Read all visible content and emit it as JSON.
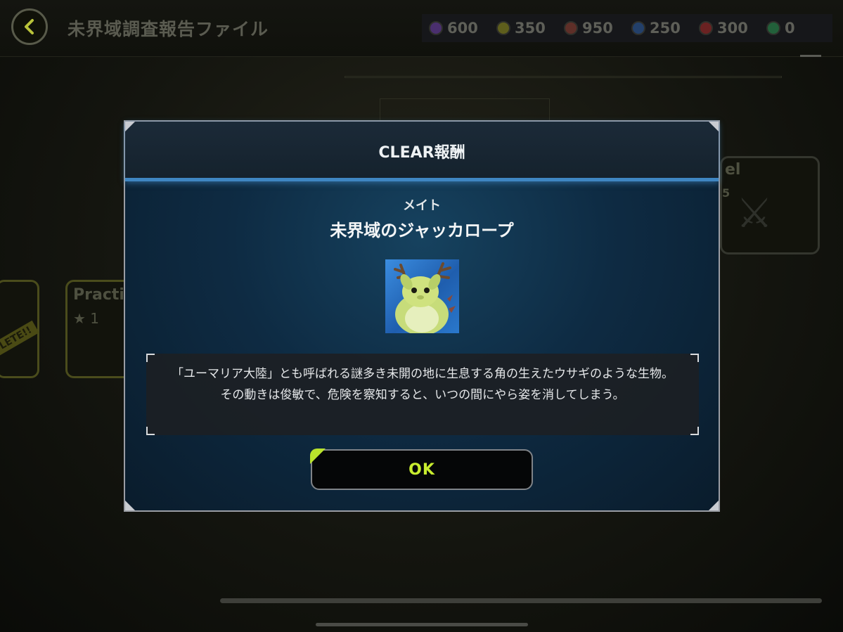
{
  "header": {
    "title": "未界域調査報告ファイル",
    "back_icon": "chevron-left-icon"
  },
  "currencies": [
    {
      "name": "purple-gem-icon",
      "color": "#6a3fa0",
      "value": "600"
    },
    {
      "name": "yellow-gem-icon",
      "color": "#8a8a22",
      "value": "350"
    },
    {
      "name": "red-brown-gem-icon",
      "color": "#8a3a30",
      "value": "950"
    },
    {
      "name": "blue-gem-icon",
      "color": "#2a5a9a",
      "value": "250"
    },
    {
      "name": "red-gem-icon",
      "color": "#9a2a2a",
      "value": "300"
    },
    {
      "name": "green-gem-icon",
      "color": "#2a8a4a",
      "value": "0"
    }
  ],
  "background": {
    "card_practice_label": "Practi",
    "card_practice_stars": "★ 1",
    "card_complete_tag": "LETE!!",
    "card_right_fragment": "el",
    "card_right_number": "5"
  },
  "dialog": {
    "title": "CLEAR報酬",
    "reward_category": "メイト",
    "reward_name": "未界域のジャッカロープ",
    "reward_icon": "jackalope-icon",
    "description": "「ユーマリア大陸」とも呼ばれる謎多き未開の地に生息する角の生えたウサギのような生物。\nその動きは俊敏で、危険を察知すると、いつの間にやら姿を消してしまう。",
    "ok_label": "OK",
    "accent_color": "#3f86c2",
    "ok_color": "#c8ec2f"
  }
}
